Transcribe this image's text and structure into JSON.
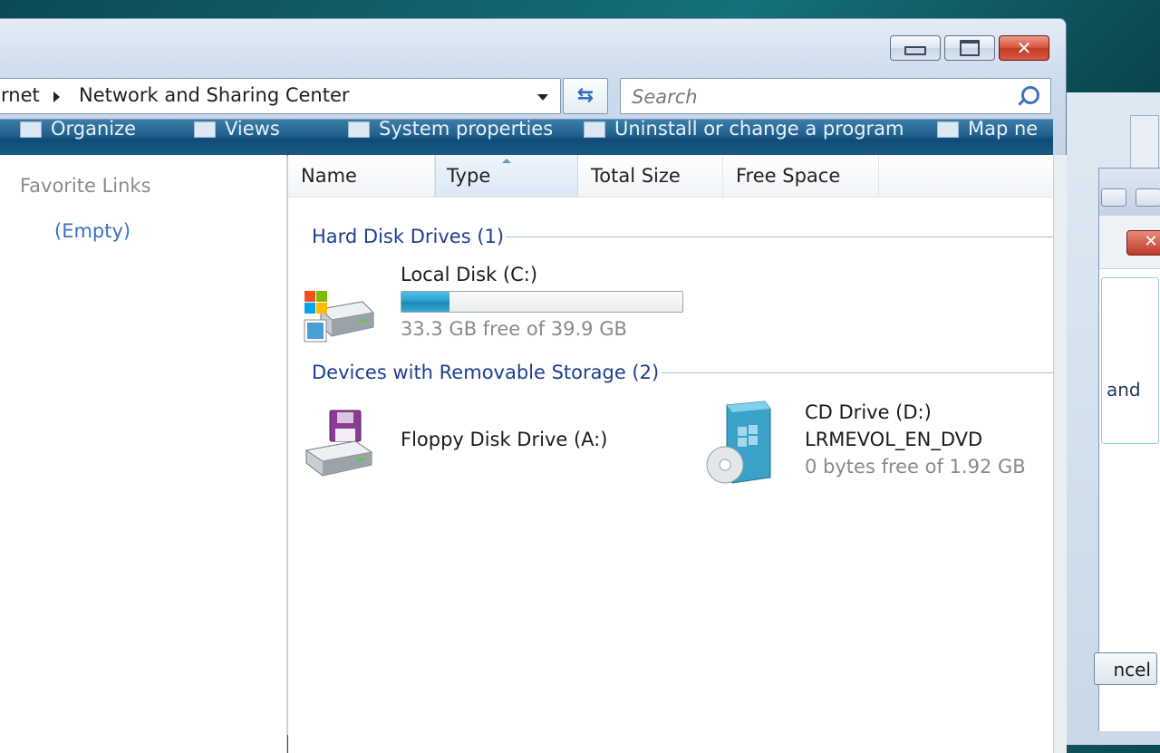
{
  "window": {
    "breadcrumb": [
      "rnet",
      "Network and Sharing Center"
    ],
    "search_placeholder": "Search",
    "caption_buttons": [
      "minimize",
      "maximize",
      "close"
    ]
  },
  "commandbar": {
    "items": [
      "Organize",
      "Views",
      "System properties",
      "Uninstall or change a program",
      "Map ne"
    ]
  },
  "nav": {
    "favorite_links_title": "Favorite Links",
    "favorite_links_empty": "(Empty)"
  },
  "columns": [
    "Name",
    "Type",
    "Total Size",
    "Free Space"
  ],
  "groups": {
    "hard_disks": {
      "title": "Hard Disk Drives (1)",
      "items": [
        {
          "label": "Local Disk (C:)",
          "sub": "33.3 GB free of 39.9 GB",
          "used_fraction": 0.17,
          "icon": "hard-disk-windows-icon"
        }
      ]
    },
    "removable": {
      "title": "Devices with Removable Storage (2)",
      "items": [
        {
          "label": "Floppy Disk Drive (A:)",
          "icon": "floppy-drive-icon"
        },
        {
          "label": "CD Drive (D:)",
          "volume": "LRMEVOL_EN_DVD",
          "sub": "0 bytes free of 1.92 GB",
          "icon": "cd-drive-icon"
        }
      ]
    }
  },
  "background_window": {
    "text": "and",
    "button": "ncel"
  },
  "colors": {
    "commandbar": "#1e5f8c",
    "group_header": "#1d3e8f",
    "link": "#3a71c1",
    "capacity_fill": "#2a9fd0",
    "close_button": "#c23a22"
  }
}
